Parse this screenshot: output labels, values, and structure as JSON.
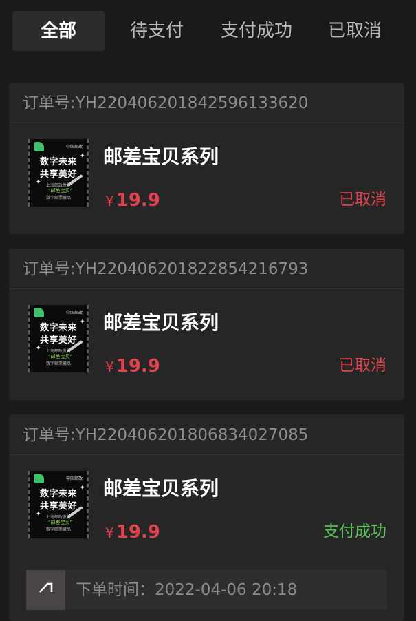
{
  "tabs": [
    {
      "label": "全部",
      "active": true
    },
    {
      "label": "待支付",
      "active": false
    },
    {
      "label": "支付成功",
      "active": false
    },
    {
      "label": "已取消",
      "active": false
    }
  ],
  "thumbnail": {
    "line1": "数字未来",
    "line2": "共享美好",
    "sub1": "上海邮政发行",
    "tag": "“邮差宝贝”",
    "sub2": "数字邮票藏品",
    "brand": "中国邮政"
  },
  "orders": [
    {
      "order_no": "订单号:YH220406201842596133620",
      "product_name": "邮差宝贝系列",
      "currency": "¥",
      "price": "19.9",
      "status": "已取消",
      "status_color": "#e0424e"
    },
    {
      "order_no": "订单号:YH220406201822854216793",
      "product_name": "邮差宝贝系列",
      "currency": "¥",
      "price": "19.9",
      "status": "已取消",
      "status_color": "#e0424e"
    },
    {
      "order_no": "订单号:YH220406201806834027085",
      "product_name": "邮差宝贝系列",
      "currency": "¥",
      "price": "19.9",
      "status": "支付成功",
      "status_color": "#56c255",
      "order_time": "下单时间：2022-04-06 20:18",
      "time_icon": "arrow-up-right-icon"
    }
  ]
}
